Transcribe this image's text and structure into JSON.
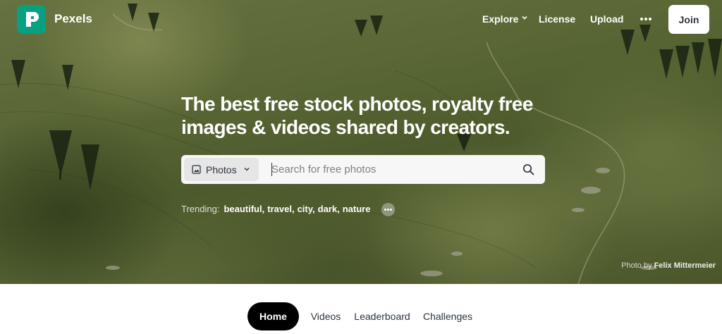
{
  "header": {
    "brand": "Pexels",
    "nav": {
      "explore": "Explore",
      "license": "License",
      "upload": "Upload",
      "join": "Join"
    }
  },
  "hero": {
    "headline": "The best free stock photos, royalty free images & videos shared by creators.",
    "search": {
      "type_selected": "Photos",
      "placeholder": "Search for free photos"
    },
    "trending": {
      "label": "Trending:",
      "terms": [
        "beautiful",
        "travel",
        "city",
        "dark",
        "nature"
      ]
    },
    "credit": {
      "prefix": "Photo by",
      "author": "Felix Mittermeier"
    }
  },
  "tabs": [
    "Home",
    "Videos",
    "Leaderboard",
    "Challenges"
  ],
  "colors": {
    "brand": "#07a081",
    "tab_active_bg": "#000000",
    "text_dark": "#2c343e"
  },
  "icons": [
    "pexels-logo-icon",
    "chevron-down-icon",
    "more-dots-icon",
    "image-icon",
    "search-icon"
  ]
}
